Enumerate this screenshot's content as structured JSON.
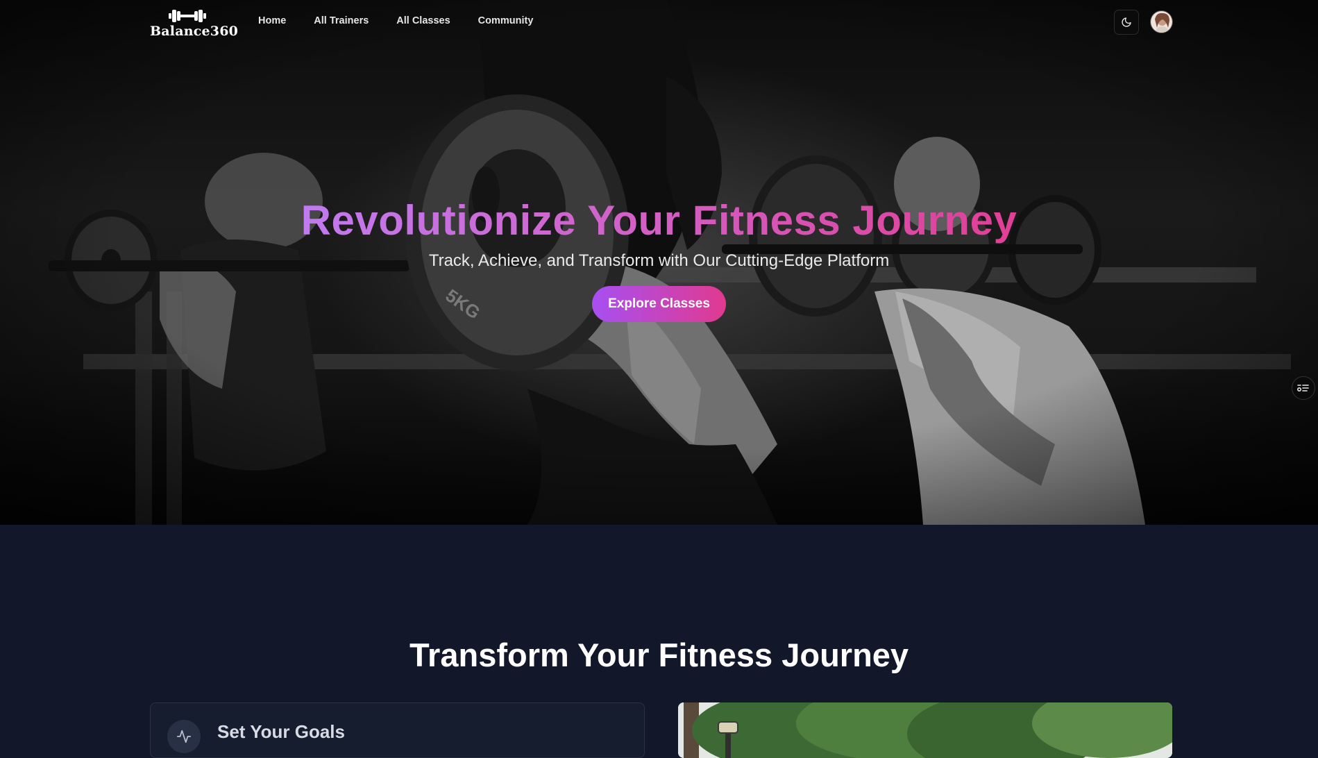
{
  "brand": {
    "name": "Balance360",
    "icon": "dumbbell-icon"
  },
  "nav": {
    "links": [
      "Home",
      "All Trainers",
      "All Classes",
      "Community"
    ],
    "theme_toggle_icon": "moon-icon",
    "avatar": "user-avatar"
  },
  "hero": {
    "title": "Revolutionize Your Fitness Journey",
    "subtitle": "Track, Achieve, and Transform with Our Cutting-Edge Platform",
    "cta_label": "Explore Classes",
    "background": "grayscale gym photo of people lifting barbells",
    "side_toggle_icon": "list-toggle-icon"
  },
  "features": {
    "title": "Transform Your Fitness Journey",
    "card": {
      "icon": "activity-icon",
      "title": "Set Your Goals"
    },
    "image": "outdoor photo with trees and lamp post"
  },
  "colors": {
    "gradient_start": "#a74ff2",
    "gradient_end": "#e13a8f",
    "section_bg": "#121829",
    "card_bg": "#161d2e"
  }
}
